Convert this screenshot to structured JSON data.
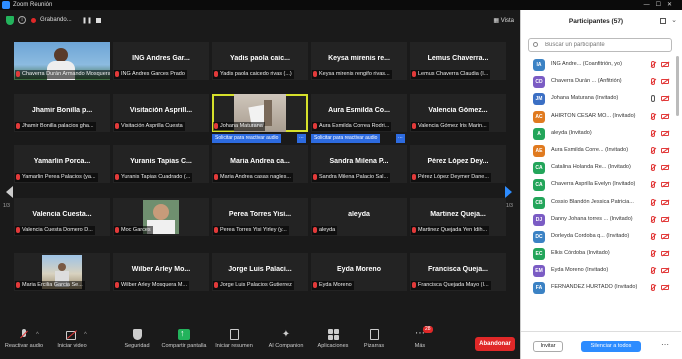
{
  "window": {
    "title": "Zoom Reunión"
  },
  "top_bar": {
    "recording_label": "Grabando...",
    "view_label": "Vista"
  },
  "tiles": [
    {
      "big": "",
      "label": "Chaverra Durán Armando Mosquera...",
      "video": "person-blue"
    },
    {
      "big": "ING Andres Gar...",
      "label": "ING Andres Garces Prado"
    },
    {
      "big": "Yadis paola caic...",
      "label": "Yadis paola caicedo rivas (...)"
    },
    {
      "big": "Keysa mirenis re...",
      "label": "Keysa mirenis rengifo rivas..."
    },
    {
      "big": "Lemus Chaverra...",
      "label": "Lemus Chaverra Claudia (I..."
    },
    {
      "big": "Jhamir Bonilla p...",
      "label": "Jhamir Bonilla palacios gha..."
    },
    {
      "big": "Visitación Asprill...",
      "label": "Visitación Asprilla Cuesta"
    },
    {
      "big": "",
      "label": "Johana Maturana",
      "video": "room"
    },
    {
      "big": "Aura Esmilda Co...",
      "label": "Aura Esmilda Correa Rodri..."
    },
    {
      "big": "Valencia Gómez...",
      "label": "Valencia Gómez Iris Marin..."
    },
    {
      "big": "Yamarlin Porca...",
      "label": "Yamarlin Perea Palacios (ya..."
    },
    {
      "big": "Yuranis Tapias C...",
      "label": "Yuranis Tapias Cuadrado (..."
    },
    {
      "big": "Maria Andrea ca...",
      "label": "Maria Andrea casas nagles..."
    },
    {
      "big": "Sandra Milena P...",
      "label": "Sandra Milena Palacio Sal..."
    },
    {
      "big": "Pérez López Dey...",
      "label": "Pérez López Deymer Dane..."
    },
    {
      "big": "Valencia Cuesta...",
      "label": "Valencia Cuesta Domero D..."
    },
    {
      "big": "",
      "label": "Moc Garces",
      "video": "man-portrait"
    },
    {
      "big": "Perea Torres Yisi...",
      "label": "Perea Torres Yisi Yirley (y..."
    },
    {
      "big": "aleyda",
      "label": "aleyda"
    },
    {
      "big": "Martinez Queja...",
      "label": "Martinez Quejada Yen Idih..."
    },
    {
      "big": "",
      "label": "Maria Ercilia Garcia Se...",
      "video": "outdoor"
    },
    {
      "big": "Wilber Arley Mo...",
      "label": "Wilber Arley Mosquera M..."
    },
    {
      "big": "Jorge Luis Palaci...",
      "label": "Jorge Luis Palacios Gutierrez"
    },
    {
      "big": "Eyda Moreno",
      "label": "Eyda Moreno"
    },
    {
      "big": "Francisca Queja...",
      "label": "Francisca Quejada Mayo (I..."
    }
  ],
  "ask_to_start_video": "Solicitar para reactivar audio",
  "pagination": {
    "left": "1/3",
    "right": "1/3"
  },
  "toolbar": {
    "items": [
      {
        "label": "Reactivar audio",
        "icon": "mic-off-icon"
      },
      {
        "label": "Iniciar video",
        "icon": "video-off-icon"
      },
      {
        "label": "Seguridad",
        "icon": "shield-icon"
      },
      {
        "label": "Compartir pantalla",
        "icon": "share-icon"
      },
      {
        "label": "Iniciar resumen",
        "icon": "summary-icon"
      },
      {
        "label": "AI Companion",
        "icon": "ai-icon"
      },
      {
        "label": "Aplicaciones",
        "icon": "apps-icon"
      },
      {
        "label": "Pizarras",
        "icon": "whiteboard-icon"
      },
      {
        "label": "Más",
        "icon": "more-icon"
      }
    ],
    "more_badge": "28",
    "end_label": "Abandonar"
  },
  "panel": {
    "title": "Participantes (57)",
    "search_placeholder": "Buscar un participante",
    "invite_label": "Invitar",
    "mute_all_label": "Silenciar a todos",
    "participants": [
      {
        "initials": "IA",
        "color": "#3b82c4",
        "name": "ING Andre... (Coanfitrión, yo)"
      },
      {
        "initials": "CD",
        "color": "#7b5cc4",
        "name": "Chaverra Durán ... (Anfitrión)"
      },
      {
        "initials": "JM",
        "color": "#3b6fc4",
        "name": "Johana Maturana (Invitado)",
        "mic_on": true
      },
      {
        "initials": "AC",
        "color": "#e07a1f",
        "name": "AHIRTON CESAR MO... (Invitado)"
      },
      {
        "initials": "A",
        "color": "#23a55a",
        "name": "aleyda (Invitado)"
      },
      {
        "initials": "AE",
        "color": "#e07a1f",
        "name": "Aura Esmilda Corre... (Invitado)"
      },
      {
        "initials": "CA",
        "color": "#23a55a",
        "name": "Catalina Holanda Re... (Invitado)"
      },
      {
        "initials": "CA",
        "color": "#23a55a",
        "name": "Chaverra Asprilla Evelyn (Invitado)"
      },
      {
        "initials": "CB",
        "color": "#23a55a",
        "name": "Cossio Blandón Jessica Patricia..."
      },
      {
        "initials": "DJ",
        "color": "#7b5cc4",
        "name": "Danny Johana torres ... (Invitado)"
      },
      {
        "initials": "DC",
        "color": "#3b82c4",
        "name": "Dorleyda Cordoba q... (Invitado)"
      },
      {
        "initials": "EC",
        "color": "#23a55a",
        "name": "Elkis Córdoba (Invitado)"
      },
      {
        "initials": "EM",
        "color": "#7b5cc4",
        "name": "Eyda Moreno (Invitado)"
      },
      {
        "initials": "FA",
        "color": "#3b82c4",
        "name": "FERNANDEZ HURTADO (Invitado)"
      }
    ]
  }
}
